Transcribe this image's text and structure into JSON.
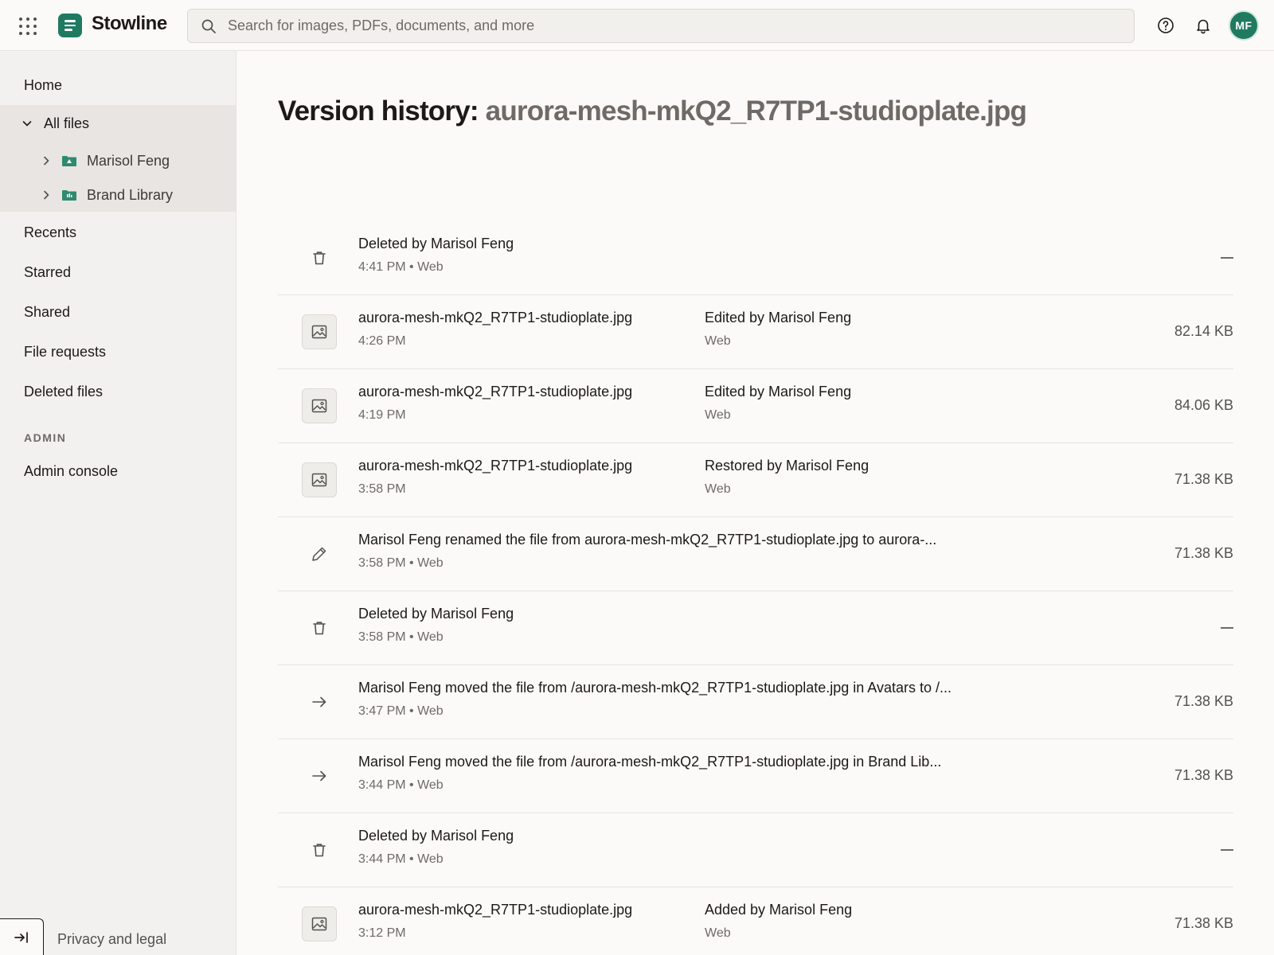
{
  "app": {
    "name": "Stowline"
  },
  "search": {
    "placeholder": "Search for images, PDFs, documents, and more"
  },
  "user": {
    "initials": "MF"
  },
  "colors": {
    "brand": "#1f7a60",
    "sidebar_bg": "#f3f1ef",
    "selected_bg": "#e8e5e2"
  },
  "sidebar": {
    "home": "Home",
    "all_files": "All files",
    "folders": [
      {
        "label": "Marisol Feng",
        "icon": "shared-folder-icon"
      },
      {
        "label": "Brand Library",
        "icon": "team-folder-icon"
      }
    ],
    "recents": "Recents",
    "starred": "Starred",
    "shared": "Shared",
    "file_requests": "File requests",
    "deleted_files": "Deleted files",
    "admin_label": "ADMIN",
    "admin_console": "Admin console",
    "privacy": "Privacy and legal"
  },
  "page": {
    "title_prefix": "Version history:",
    "title_file": "aurora-mesh-mkQ2_R7TP1-studioplate.jpg"
  },
  "versions": [
    {
      "icon": "trash-icon",
      "title": "Deleted by Marisol Feng",
      "sub": "4:41 PM • Web",
      "size": ""
    },
    {
      "icon": "image-icon",
      "title": "aurora-mesh-mkQ2_R7TP1-studioplate.jpg",
      "sub": "4:26 PM",
      "action": "Edited by Marisol Feng",
      "source": "Web",
      "size": "82.14 KB"
    },
    {
      "icon": "image-icon",
      "title": "aurora-mesh-mkQ2_R7TP1-studioplate.jpg",
      "sub": "4:19 PM",
      "action": "Edited by Marisol Feng",
      "source": "Web",
      "size": "84.06 KB"
    },
    {
      "icon": "image-icon",
      "title": "aurora-mesh-mkQ2_R7TP1-studioplate.jpg",
      "sub": "3:58 PM",
      "action": "Restored by Marisol Feng",
      "source": "Web",
      "size": "71.38 KB"
    },
    {
      "icon": "pencil-icon",
      "title": "Marisol Feng renamed the file from aurora-mesh-mkQ2_R7TP1-studioplate.jpg to aurora-...",
      "sub": "3:58 PM • Web",
      "size": "71.38 KB"
    },
    {
      "icon": "trash-icon",
      "title": "Deleted by Marisol Feng",
      "sub": "3:58 PM • Web",
      "size": ""
    },
    {
      "icon": "arrow-right-icon",
      "title": "Marisol Feng moved the file from /aurora-mesh-mkQ2_R7TP1-studioplate.jpg in Avatars to /...",
      "sub": "3:47 PM • Web",
      "size": "71.38 KB"
    },
    {
      "icon": "arrow-right-icon",
      "title": "Marisol Feng moved the file from /aurora-mesh-mkQ2_R7TP1-studioplate.jpg in Brand Lib...",
      "sub": "3:44 PM • Web",
      "size": "71.38 KB"
    },
    {
      "icon": "trash-icon",
      "title": "Deleted by Marisol Feng",
      "sub": "3:44 PM • Web",
      "size": ""
    },
    {
      "icon": "image-icon",
      "title": "aurora-mesh-mkQ2_R7TP1-studioplate.jpg",
      "sub": "3:12 PM",
      "action": "Added by Marisol Feng",
      "source": "Web",
      "size": "71.38 KB"
    }
  ]
}
